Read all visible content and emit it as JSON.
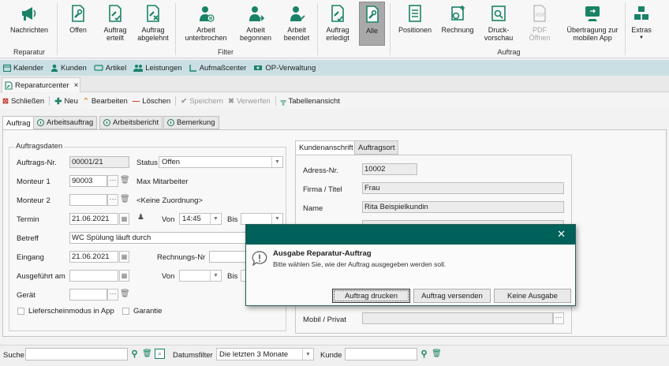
{
  "ribbon": {
    "buttons": {
      "nachrichten": "Nachrichten",
      "offen": "Offen",
      "auftrag_erteilt": "Auftrag\nerteilt",
      "auftrag_abgelehnt": "Auftrag\nabgelehnt",
      "arbeit_unterbrochen": "Arbeit\nunterbrochen",
      "arbeit_begonnen": "Arbeit\nbegonnen",
      "arbeit_beendet": "Arbeit\nbeendet",
      "auftrag_erledigt": "Auftrag\nerledigt",
      "alle": "Alle",
      "positionen": "Positionen",
      "rechnung": "Rechnung",
      "druckvorschau": "Druck-\nvorschau",
      "pdf_oeffnen": "PDF\nÖffnen",
      "uebertragung": "Übertragung zur\nmobilen App",
      "extras": "Extras"
    },
    "groups": {
      "reparatur": "Reparatur",
      "filter": "Filter",
      "auftrag": "Auftrag"
    },
    "accent": "#1a8266"
  },
  "nav": {
    "items": [
      "Kalender",
      "Kunden",
      "Artikel",
      "Leistungen",
      "Aufmaßcenter",
      "OP-Verwaltung"
    ]
  },
  "doc_tab": {
    "label": "Reparaturcenter",
    "close": "×"
  },
  "toolbar": {
    "schliessen": "Schließen",
    "neu": "Neu",
    "bearbeiten": "Bearbeiten",
    "loeschen": "Löschen",
    "speichern": "Speichern",
    "verwerfen": "Verwerfen",
    "tabellenansicht": "Tabellenansicht"
  },
  "subtabs": [
    "Auftrag",
    "Arbeitsauftrag",
    "Arbeitsbericht",
    "Bemerkung"
  ],
  "auftragsdaten": {
    "legend": "Auftragsdaten",
    "auftrags_nr_label": "Auftrags-Nr.",
    "auftrags_nr": "00001/21",
    "status_label": "Status",
    "status": "Offen",
    "monteur1_label": "Monteur 1",
    "monteur1": "90003",
    "monteur1_name": "Max Mitarbeiter",
    "monteur2_label": "Monteur 2",
    "monteur2_name": "<Keine Zuordnung>",
    "termin_label": "Termin",
    "termin": "21.06.2021",
    "von_label": "Von",
    "von": "14:45",
    "bis_label": "Bis",
    "betreff_label": "Betreff",
    "betreff": "WC Spülung läuft durch",
    "eingang_label": "Eingang",
    "eingang": "21.06.2021",
    "rechnungs_nr_label": "Rechnungs-Nr",
    "ausgefuehrt_label": "Ausgeführt am",
    "von2_label": "Von",
    "bis2_label": "Bis",
    "geraet_label": "Gerät",
    "lieferschein_label": "Lieferscheinmodus in App",
    "garantie_label": "Garantie",
    "dots": "···"
  },
  "kunde": {
    "tabs": [
      "Kundenanschrift",
      "Auftragsort"
    ],
    "adress_nr_label": "Adress-Nr.",
    "adress_nr": "10002",
    "firma_label": "Firma / Titel",
    "firma": "Frau",
    "name_label": "Name",
    "name": "Rita Beispielkundin",
    "mobil_label": "Mobil / Privat",
    "dots": "···"
  },
  "dialog": {
    "close": "✕",
    "title": "Ausgabe Reparatur-Auftrag",
    "message": "Bitte wählen Sie, wie der Auftrag ausgegeben werden soll.",
    "btn_drucken": "Auftrag drucken",
    "btn_versenden": "Auftrag versenden",
    "btn_keine": "Keine Ausgabe",
    "header_color": "#00605a"
  },
  "bottom": {
    "suche_label": "Suche",
    "datumsfilter_label": "Datumsfilter",
    "datumsfilter": "Die letzten 3 Monate",
    "kunde_label": "Kunde"
  }
}
